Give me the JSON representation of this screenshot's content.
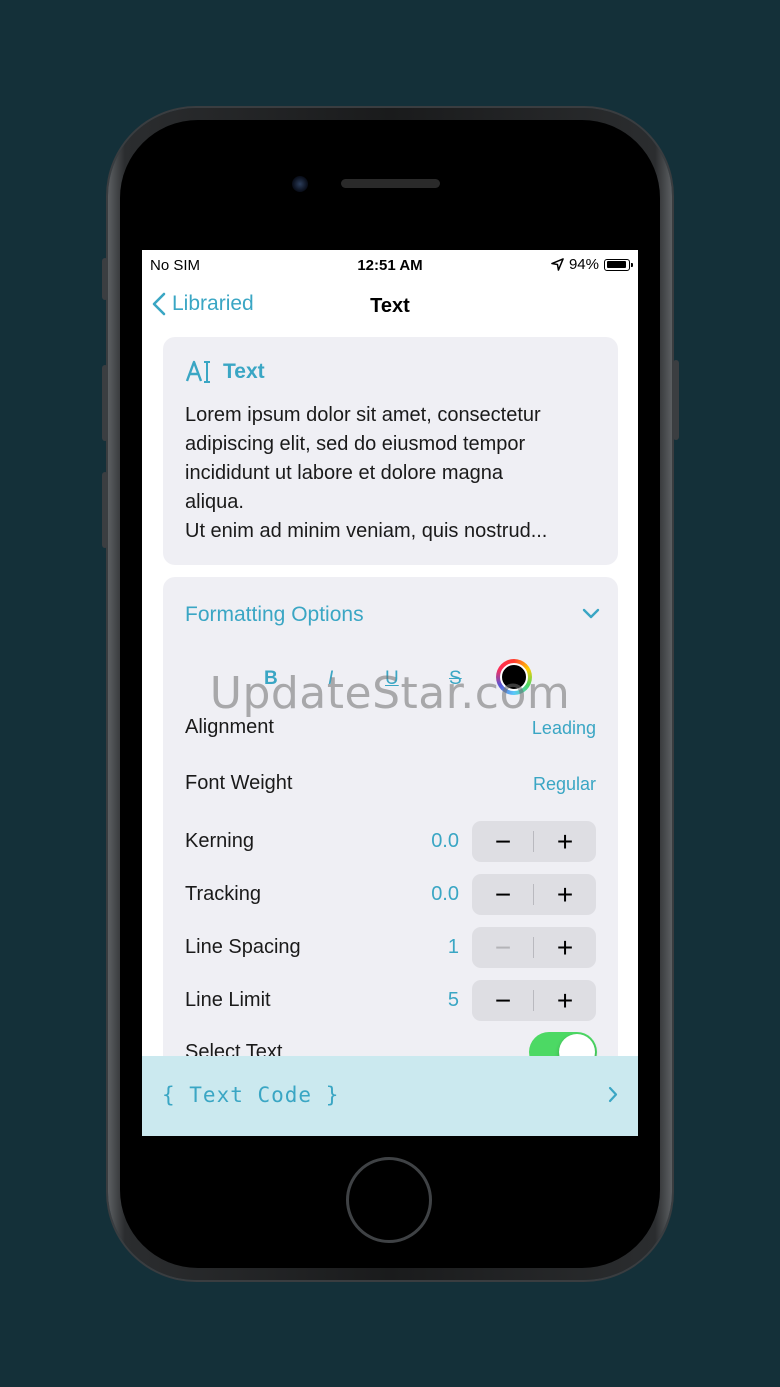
{
  "status_bar": {
    "carrier": "No SIM",
    "time": "12:51 AM",
    "battery": "94%"
  },
  "nav": {
    "back_label": "Libraried",
    "title": "Text"
  },
  "text_card": {
    "title": "Text",
    "body_lines": [
      "Lorem ipsum dolor sit amet, consectetur",
      "adipiscing elit, sed do eiusmod tempor",
      "incididunt ut labore et dolore magna",
      "aliqua.",
      "Ut enim ad minim veniam, quis nostrud..."
    ]
  },
  "formatting": {
    "header": "Formatting Options",
    "style_buttons": {
      "bold": "B",
      "italic": "I",
      "underline": "U",
      "strikethrough": "S"
    },
    "color_value": "#000000",
    "alignment": {
      "label": "Alignment",
      "value": "Leading"
    },
    "font_weight": {
      "label": "Font Weight",
      "value": "Regular"
    },
    "kerning": {
      "label": "Kerning",
      "value": "0.0"
    },
    "tracking": {
      "label": "Tracking",
      "value": "0.0"
    },
    "line_spacing": {
      "label": "Line Spacing",
      "value": "1"
    },
    "line_limit": {
      "label": "Line Limit",
      "value": "5"
    },
    "select_text": {
      "label": "Select Text",
      "on": true
    },
    "stepper_minus": "−",
    "stepper_plus": "+"
  },
  "code_bar": {
    "label": "{ Text Code }"
  },
  "watermark": "UpdateStar.com",
  "colors": {
    "accent": "#3aa6c4",
    "background": "#143039",
    "card": "#efeff4",
    "toggle_on": "#4cd964",
    "code_bar": "#cbe9ef"
  }
}
